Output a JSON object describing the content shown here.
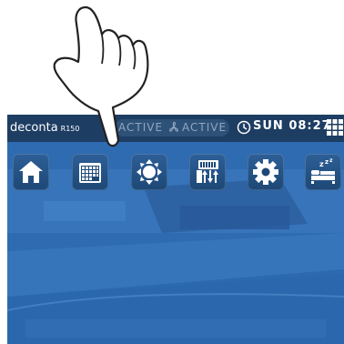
{
  "status_bar": {
    "brand": "deconta",
    "model": "R150",
    "mode_left": "ACTIVE",
    "mode_right": "ACTIVE",
    "day": "SUN",
    "time": "08:27"
  },
  "menu": [
    {
      "id": "home",
      "icon": "home-icon"
    },
    {
      "id": "schedule",
      "icon": "calendar-icon"
    },
    {
      "id": "pressure",
      "icon": "pressure-arrows-icon"
    },
    {
      "id": "filter",
      "icon": "filter-airflow-icon"
    },
    {
      "id": "settings",
      "icon": "gear-icon"
    },
    {
      "id": "sleep",
      "icon": "bed-sleep-icon"
    }
  ],
  "colors": {
    "statusbar": "#1e3d63",
    "tile": "#1d4876",
    "background": "#2f6db3",
    "icon": "#ffffff"
  }
}
